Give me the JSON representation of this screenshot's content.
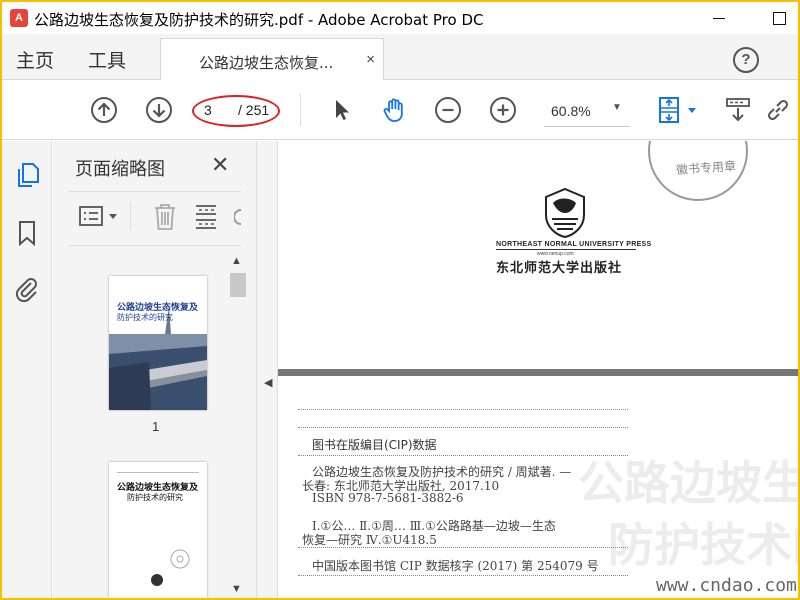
{
  "window": {
    "title": "公路边坡生态恢复及防护技术的研究.pdf - Adobe Acrobat Pro DC",
    "app_icon_glyph": "A"
  },
  "tabs": {
    "home_label": "主页",
    "tools_label": "工具",
    "document_tab_label": "公路边坡生态恢复...",
    "document_tab_close": "×",
    "help_glyph": "?"
  },
  "toolbar": {
    "page_current": "3",
    "page_total": "/ 251",
    "zoom_value": "60.8%",
    "zoom_caret": "▼"
  },
  "thumbnails_panel": {
    "title": "页面缩略图",
    "close_glyph": "✕",
    "thumbnails": [
      {
        "page_label": "1",
        "title": "公路边坡生态恢复及",
        "subtitle": "防护技术的研究"
      },
      {
        "page_label": "",
        "title": "公路边坡生态恢复及",
        "subtitle": "防护技术的研究"
      }
    ]
  },
  "document": {
    "stamp_text": "徽书专用章",
    "publisher_en": "NORTHEAST NORMAL UNIVERSITY PRESS",
    "publisher_url": "www.nenup.com",
    "publisher_cn": "东北师范大学出版社",
    "cip_heading": "图书在版编目(CIP)数据",
    "cip_lines": [
      "公路边坡生态恢复及防护技术的研究 / 周斌著.  —",
      "长春: 东北师范大学出版社,  2017.10",
      "ISBN  978-7-5681-3882-6",
      "Ⅰ.①公…  Ⅱ.①周…  Ⅲ.①公路路基—边坡—生态",
      "恢复—研究  Ⅳ.①U418.5",
      "中国版本图书馆 CIP 数据核字 (2017) 第 254079 号"
    ],
    "background_text_1": "公路边坡生态",
    "background_text_2": "防护技术的研",
    "watermark": "www.cndao.com"
  },
  "colors": {
    "frame": "#f2c200",
    "highlight_circle": "#dd2222",
    "accent_blue": "#1473e6",
    "cover_blue": "#1f3f9a"
  },
  "icons": {
    "prev_page": "arrow-up-circle-icon",
    "next_page": "arrow-down-circle-icon",
    "select": "cursor-arrow-icon",
    "hand": "hand-tool-icon",
    "zoom_out": "minus-circle-icon",
    "zoom_in": "plus-circle-icon",
    "fit_page": "fit-page-icon",
    "scroll_mode": "scroll-mode-icon",
    "link": "link-icon",
    "pages": "page-thumbnails-icon",
    "bookmarks": "bookmark-icon",
    "attachments": "paperclip-icon",
    "options": "options-menu-icon",
    "delete": "trash-icon",
    "extract": "extract-icon"
  }
}
